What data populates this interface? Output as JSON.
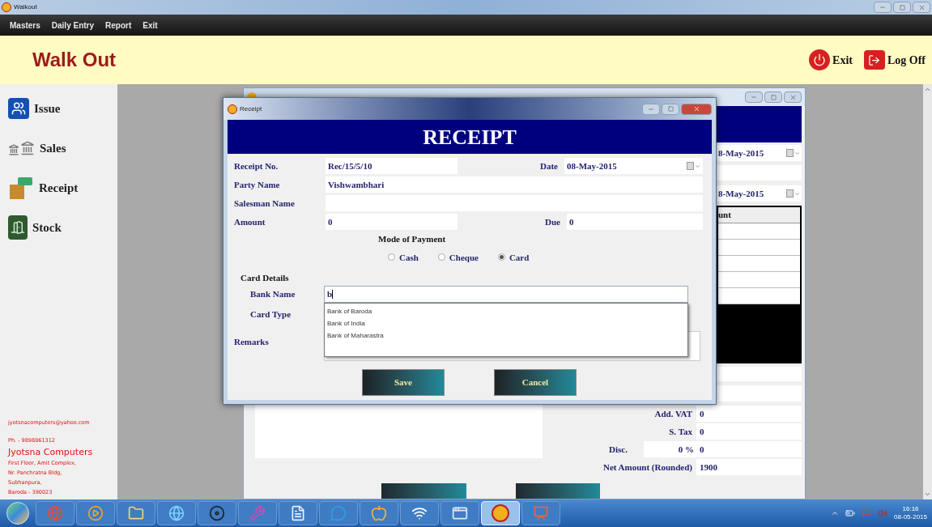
{
  "window": {
    "title": "Walkout"
  },
  "menu": [
    "Masters",
    "Daily Entry",
    "Report",
    "Exit"
  ],
  "header": {
    "title": "Walk Out",
    "actions": [
      {
        "label": "Exit",
        "kind": "exit"
      },
      {
        "label": "Log Off",
        "kind": "logoff"
      }
    ]
  },
  "sidebar": {
    "items": [
      {
        "label": "Issue",
        "kind": "issue"
      },
      {
        "label": "Sales",
        "kind": "sales"
      },
      {
        "label": "Receipt",
        "kind": "receipt"
      },
      {
        "label": "Stock",
        "kind": "stock"
      }
    ],
    "contact": [
      {
        "text": "jyotsnacomputers@yahoo.com",
        "kind": "line"
      },
      {
        "text": "Ph. - 9898061312",
        "kind": "line"
      },
      {
        "text": "Jyotsna Computers",
        "kind": "name"
      },
      {
        "text": "First Floor, Amit Complex,",
        "kind": "line"
      },
      {
        "text": "Nr. Panchratna Bldg,",
        "kind": "line"
      },
      {
        "text": "Subhanpura,",
        "kind": "line"
      },
      {
        "text": "Baroda - 390023",
        "kind": "line"
      }
    ]
  },
  "background_window": {
    "dates": [
      "8-May-2015",
      "8-May-2015"
    ],
    "table_header": "unt",
    "totals": [
      {
        "label": "Add. VAT",
        "value": "0"
      },
      {
        "label": "S. Tax",
        "value": "0"
      },
      {
        "label": "Disc.",
        "percent": "0 %",
        "value": "0"
      },
      {
        "label": "Net Amount (Rounded)",
        "value": "1900"
      }
    ]
  },
  "dialog": {
    "title": "Receipt",
    "heading": "RECEIPT",
    "receipt_no": {
      "label": "Receipt No.",
      "value": "Rec/15/5/10"
    },
    "date": {
      "label": "Date",
      "value": "08-May-2015"
    },
    "party_name": {
      "label": "Party Name",
      "value": "Vishwambhari"
    },
    "salesman_name": {
      "label": "Salesman Name"
    },
    "amount": {
      "label": "Amount",
      "value": "0"
    },
    "due": {
      "label": "Due",
      "value": "0"
    },
    "mode_of_payment": {
      "label": "Mode of Payment",
      "options": [
        {
          "label": "Cash",
          "selected": false
        },
        {
          "label": "Cheque",
          "selected": false
        },
        {
          "label": "Card",
          "selected": true
        }
      ]
    },
    "card_details": {
      "title": "Card Details",
      "bank_name": {
        "label": "Bank Name",
        "value": "b",
        "suggestions": [
          "Bank of Baroda",
          "Bank of India",
          "Bank of Maharastra"
        ]
      },
      "card_type": {
        "label": "Card Type"
      }
    },
    "remarks": {
      "label": "Remarks"
    },
    "buttons": [
      "Save",
      "Cancel"
    ]
  },
  "taskbar": {
    "apps": [
      {
        "kind": "browser",
        "active": false
      },
      {
        "kind": "media",
        "active": false
      },
      {
        "kind": "folder",
        "active": false
      },
      {
        "kind": "globe",
        "active": false
      },
      {
        "kind": "disc",
        "active": false
      },
      {
        "kind": "wrench",
        "active": false
      },
      {
        "kind": "document",
        "active": false
      },
      {
        "kind": "chat",
        "active": false
      },
      {
        "kind": "apple",
        "active": false
      },
      {
        "kind": "wifi",
        "active": false
      },
      {
        "kind": "window",
        "active": false
      },
      {
        "kind": "logo",
        "active": true
      },
      {
        "kind": "presentation",
        "active": false
      }
    ],
    "clock": {
      "time": "16:16",
      "date": "08-05-2015"
    }
  }
}
